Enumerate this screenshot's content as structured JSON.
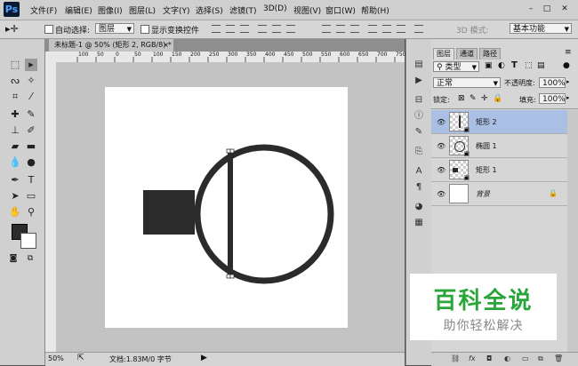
{
  "app": {
    "logo": "Ps"
  },
  "menu": [
    "文件(F)",
    "编辑(E)",
    "图像(I)",
    "图层(L)",
    "文字(Y)",
    "选择(S)",
    "滤镜(T)",
    "3D(D)",
    "视图(V)",
    "窗口(W)",
    "帮助(H)"
  ],
  "window_controls": [
    "–",
    "□",
    "✕"
  ],
  "options": {
    "auto_select_label": "自动选择:",
    "auto_select_value": "图层",
    "show_transform_label": "显示变换控件",
    "mode3d_label": "3D 模式:",
    "workspace": "基本功能"
  },
  "document": {
    "tab_title": "未标题-1 @ 50% (矩形 2, RGB/8) *",
    "close": "×",
    "ruler_labels": [
      "100",
      "50",
      "0",
      "50",
      "100",
      "150",
      "200",
      "250",
      "300",
      "350",
      "400",
      "450",
      "500",
      "550",
      "600",
      "650",
      "700",
      "750"
    ],
    "zoom": "50%",
    "doc_info": "文档:1.83M/0 字节"
  },
  "layers_panel": {
    "tabs": [
      "图层",
      "通道",
      "路径"
    ],
    "filter_label": "类型",
    "blend_mode": "正常",
    "opacity_label": "不透明度:",
    "opacity_value": "100%",
    "lock_label": "锁定:",
    "fill_label": "填充:",
    "fill_value": "100%",
    "layers": [
      {
        "name": "矩形 2",
        "selected": true
      },
      {
        "name": "椭圆 1",
        "selected": false
      },
      {
        "name": "矩形 1",
        "selected": false
      },
      {
        "name": "背景",
        "selected": false
      }
    ],
    "bottom_icons": [
      "link-icon",
      "fx-icon",
      "mask-icon",
      "adjustment-icon",
      "group-icon",
      "new-layer-icon",
      "trash-icon"
    ]
  },
  "watermark": {
    "title": "百科全说",
    "subtitle": "助你轻松解决"
  },
  "colors": {
    "selected_layer": "#a9bfe4",
    "shape_fill": "#2b2b2b",
    "watermark_green": "#2aa53a"
  }
}
